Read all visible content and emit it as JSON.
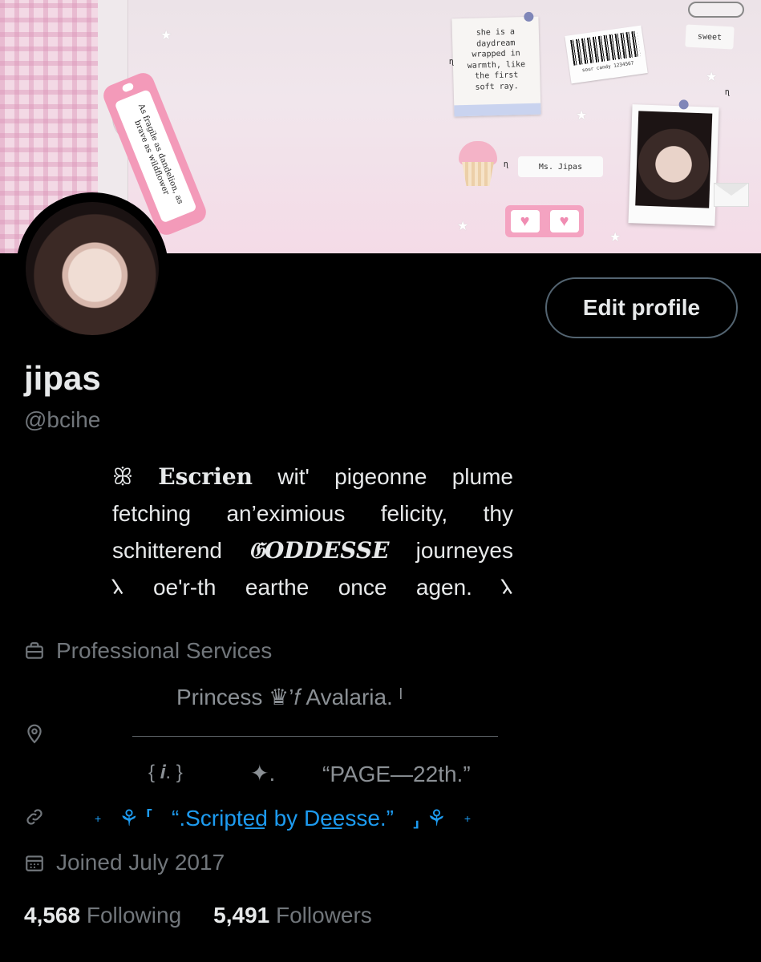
{
  "banner": {
    "tag_text": "As fragile as dandelion, as brave as wildflower",
    "note_text": "she is a\ndaydream\nwrapped in\nwarmth, like\nthe first\nsoft ray.",
    "barcode_label": "sour candy 1234567",
    "sweet_label": "sweet",
    "name_tag": "Ms. Jipas"
  },
  "profile": {
    "edit_button_label": "Edit profile",
    "display_name": "jipas",
    "handle": "@bcihe"
  },
  "bio": {
    "line1": [
      "ꕥ",
      "Escrien",
      "wit'",
      "pigeonne",
      "plume"
    ],
    "line2": [
      "fetching",
      "an’eximious",
      "felicity,",
      "thy"
    ],
    "line3": [
      "schitterend",
      "𝔊ODDESSE",
      "journeyes"
    ],
    "line4": [
      "𐰳",
      "oe'r-th",
      "earthe",
      "once",
      "agen.",
      "𐰳"
    ]
  },
  "category": "Professional Services",
  "location": {
    "line1": "Princess   ♛’𝑓   Avalaria.  ˡ",
    "line2_left": "{ 𝒊. }",
    "line2_mid": "✦.",
    "line2_right": "“PAGE—22th.”"
  },
  "link": {
    "prefix": "+",
    "open_glyph": "⚘  ⸢",
    "text": "“.Scripte͟d   by   De͟esse.”",
    "close_glyph": "⸥  ⚘",
    "suffix": "+"
  },
  "joined": "Joined July 2017",
  "stats": {
    "following_count": "4,568",
    "following_label": "Following",
    "followers_count": "5,491",
    "followers_label": "Followers"
  },
  "icons": {
    "category": "briefcase-icon",
    "location": "location-pin-icon",
    "link": "link-icon",
    "joined": "calendar-icon"
  },
  "colors": {
    "background": "#000000",
    "text": "#e7e9ea",
    "muted": "#71767b",
    "link": "#1d9bf0",
    "button_border": "#536471"
  }
}
